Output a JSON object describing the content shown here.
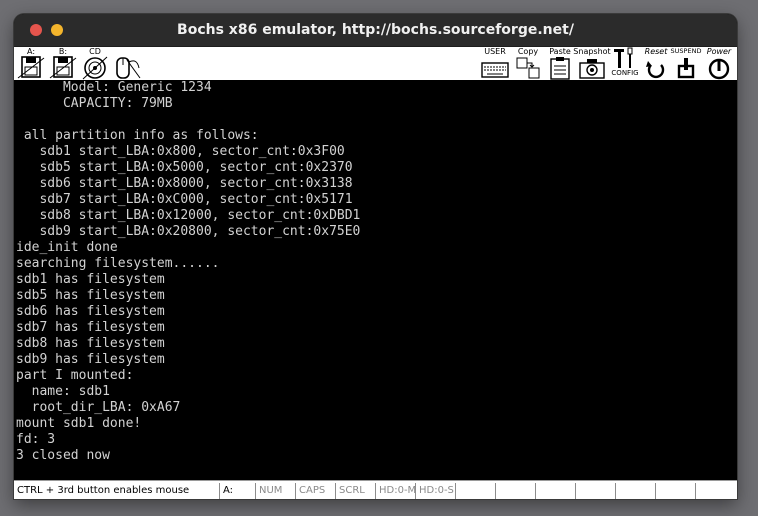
{
  "window": {
    "title": "Bochs x86 emulator, http://bochs.sourceforge.net/"
  },
  "toolbar": {
    "floppy_a_label": "A:",
    "floppy_b_label": "B:",
    "cdrom_label": "CD",
    "user_label": "USER",
    "copy_label": "Copy",
    "paste_label": "Paste",
    "snapshot_label": "Snapshot",
    "config_label": "CONFIG",
    "reset_label": "Reset",
    "suspend_label": "SUSPEND",
    "power_label": "Power"
  },
  "console": {
    "lines": [
      "      Model: Generic 1234",
      "      CAPACITY: 79MB",
      "",
      " all partition info as follows:",
      "   sdb1 start_LBA:0x800, sector_cnt:0x3F00",
      "   sdb5 start_LBA:0x5000, sector_cnt:0x2370",
      "   sdb6 start_LBA:0x8000, sector_cnt:0x3138",
      "   sdb7 start_LBA:0xC000, sector_cnt:0x5171",
      "   sdb8 start_LBA:0x12000, sector_cnt:0xDBD1",
      "   sdb9 start_LBA:0x20800, sector_cnt:0x75E0",
      "ide_init done",
      "searching filesystem......",
      "sdb1 has filesystem",
      "sdb5 has filesystem",
      "sdb6 has filesystem",
      "sdb7 has filesystem",
      "sdb8 has filesystem",
      "sdb9 has filesystem",
      "part I mounted:",
      "  name: sdb1",
      "  root_dir_LBA: 0xA67",
      "mount sdb1 done!",
      "fd: 3",
      "3 closed now"
    ]
  },
  "statusbar": {
    "message": "CTRL + 3rd button enables mouse",
    "floppy": "A:",
    "num": "NUM",
    "caps": "CAPS",
    "scrl": "SCRL",
    "hd0_master": "HD:0-M",
    "hd0_slave": "HD:0-S"
  }
}
